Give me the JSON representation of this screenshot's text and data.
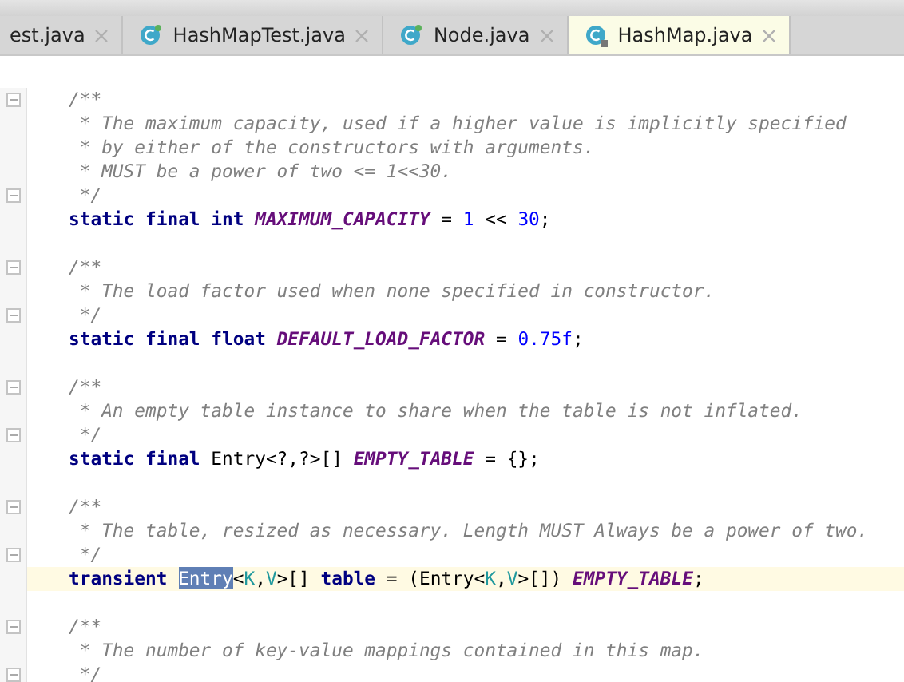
{
  "tabs": [
    {
      "label": "est.java",
      "selected": false,
      "kind": "plain"
    },
    {
      "label": "HashMapTest.java",
      "selected": false,
      "kind": "class"
    },
    {
      "label": "Node.java",
      "selected": false,
      "kind": "class"
    },
    {
      "label": "HashMap.java",
      "selected": true,
      "kind": "locked"
    }
  ],
  "code_lines": [
    {
      "fold": true,
      "current": false,
      "tokens": [
        {
          "kind": "comment",
          "text": "/**"
        }
      ]
    },
    {
      "fold": false,
      "current": false,
      "tokens": [
        {
          "kind": "comment",
          "text": " * The maximum capacity, used if a higher value is implicitly specified"
        }
      ]
    },
    {
      "fold": false,
      "current": false,
      "tokens": [
        {
          "kind": "comment",
          "text": " * by either of the constructors with arguments."
        }
      ]
    },
    {
      "fold": false,
      "current": false,
      "tokens": [
        {
          "kind": "comment",
          "text": " * MUST be a power of two <= 1<<30."
        }
      ]
    },
    {
      "fold": true,
      "current": false,
      "tokens": [
        {
          "kind": "comment",
          "text": " */"
        }
      ]
    },
    {
      "fold": false,
      "current": false,
      "tokens": [
        {
          "kind": "keyword",
          "text": "static final int "
        },
        {
          "kind": "constant",
          "text": "MAXIMUM_CAPACITY"
        },
        {
          "kind": "plain",
          "text": " = "
        },
        {
          "kind": "number",
          "text": "1"
        },
        {
          "kind": "plain",
          "text": " << "
        },
        {
          "kind": "number",
          "text": "30"
        },
        {
          "kind": "plain",
          "text": ";"
        }
      ]
    },
    {
      "fold": false,
      "current": false
    },
    {
      "fold": true,
      "current": false,
      "tokens": [
        {
          "kind": "comment",
          "text": "/**"
        }
      ]
    },
    {
      "fold": false,
      "current": false,
      "tokens": [
        {
          "kind": "comment",
          "text": " * The load factor used when none specified in constructor."
        }
      ]
    },
    {
      "fold": true,
      "current": false,
      "tokens": [
        {
          "kind": "comment",
          "text": " */"
        }
      ]
    },
    {
      "fold": false,
      "current": false,
      "tokens": [
        {
          "kind": "keyword",
          "text": "static final float "
        },
        {
          "kind": "constant",
          "text": "DEFAULT_LOAD_FACTOR"
        },
        {
          "kind": "plain",
          "text": " = "
        },
        {
          "kind": "number",
          "text": "0.75f"
        },
        {
          "kind": "plain",
          "text": ";"
        }
      ]
    },
    {
      "fold": false,
      "current": false
    },
    {
      "fold": true,
      "current": false,
      "tokens": [
        {
          "kind": "comment",
          "text": "/**"
        }
      ]
    },
    {
      "fold": false,
      "current": false,
      "tokens": [
        {
          "kind": "comment",
          "text": " * An empty table instance to share when the table is not inflated."
        }
      ]
    },
    {
      "fold": true,
      "current": false,
      "tokens": [
        {
          "kind": "comment",
          "text": " */"
        }
      ]
    },
    {
      "fold": false,
      "current": false,
      "tokens": [
        {
          "kind": "keyword",
          "text": "static final "
        },
        {
          "kind": "plain",
          "text": "Entry<?,?>[] "
        },
        {
          "kind": "constant",
          "text": "EMPTY_TABLE"
        },
        {
          "kind": "plain",
          "text": " = {};"
        }
      ]
    },
    {
      "fold": false,
      "current": false
    },
    {
      "fold": true,
      "current": false,
      "tokens": [
        {
          "kind": "comment",
          "text": "/**"
        }
      ]
    },
    {
      "fold": false,
      "current": false,
      "tokens": [
        {
          "kind": "comment",
          "text": " * The table, resized as necessary. Length MUST Always be a power of two."
        }
      ]
    },
    {
      "fold": true,
      "current": false,
      "tokens": [
        {
          "kind": "comment",
          "text": " */"
        }
      ]
    },
    {
      "fold": false,
      "current": true,
      "tokens": [
        {
          "kind": "keyword",
          "text": "transient "
        },
        {
          "kind": "selection",
          "text": "Entry"
        },
        {
          "kind": "plain",
          "text": "<"
        },
        {
          "kind": "type_param",
          "text": "K"
        },
        {
          "kind": "plain",
          "text": ","
        },
        {
          "kind": "type_param",
          "text": "V"
        },
        {
          "kind": "plain",
          "text": ">[] "
        },
        {
          "kind": "keyword",
          "text": "table"
        },
        {
          "kind": "plain",
          "text": " = (Entry<"
        },
        {
          "kind": "type_param",
          "text": "K"
        },
        {
          "kind": "plain",
          "text": ","
        },
        {
          "kind": "type_param",
          "text": "V"
        },
        {
          "kind": "plain",
          "text": ">[]) "
        },
        {
          "kind": "constant",
          "text": "EMPTY_TABLE"
        },
        {
          "kind": "plain",
          "text": ";"
        }
      ]
    },
    {
      "fold": false,
      "current": false
    },
    {
      "fold": true,
      "current": false,
      "tokens": [
        {
          "kind": "comment",
          "text": "/**"
        }
      ]
    },
    {
      "fold": false,
      "current": false,
      "tokens": [
        {
          "kind": "comment",
          "text": " * The number of key-value mappings contained in this map."
        }
      ]
    },
    {
      "fold": true,
      "current": false,
      "tokens": [
        {
          "kind": "comment",
          "text": " */"
        }
      ]
    }
  ]
}
